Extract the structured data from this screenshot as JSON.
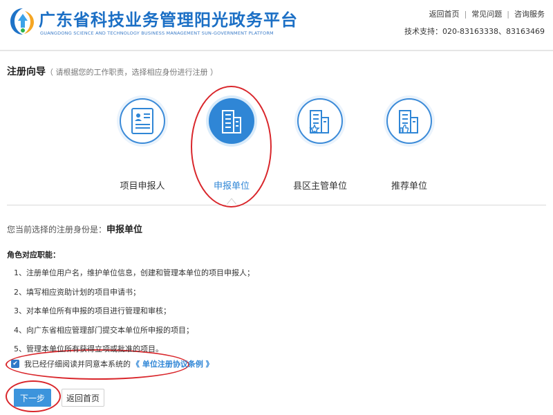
{
  "header": {
    "title": "广东省科技业务管理阳光政务平台",
    "subtitle": "GUANGDONG SCIENCE AND TECHNOLOGY BUSINESS MANAGEMENT SUN-GOVERNMENT PLATFORM",
    "links": [
      "返回首页",
      "常见问题",
      "咨询服务"
    ],
    "support": "技术支持：020-83163338、83163469",
    "brand_color": "#1b6fc5"
  },
  "guide": {
    "title": "注册向导",
    "hint": "（ 请根据您的工作职责，选择相应身份进行注册 ）"
  },
  "roles": [
    {
      "label": "项目申报人",
      "icon": "id-card-icon",
      "active": false
    },
    {
      "label": "申报单位",
      "icon": "building-icon",
      "active": true
    },
    {
      "label": "县区主管单位",
      "icon": "building-star-icon",
      "active": false
    },
    {
      "label": "推荐单位",
      "icon": "building-thumbsup-icon",
      "active": false
    }
  ],
  "current": {
    "prefix": "您当前选择的注册身份是：",
    "value": "申报单位"
  },
  "duties": {
    "title": "角色对应职能：",
    "items": [
      "1、注册单位用户名，维护单位信息，创建和管理本单位的项目申报人；",
      "2、填写相应资助计划的项目申请书；",
      "3、对本单位所有申报的项目进行管理和审核；",
      "4、向广东省相应管理部门提交本单位所申报的项目；",
      "5、管理本单位所有获得立项或批准的项目。"
    ]
  },
  "agreement": {
    "checked": true,
    "text": "我已经仔细阅读并同意本系统的",
    "link": "《 单位注册协议条例 》"
  },
  "buttons": {
    "next": "下一步",
    "home": "返回首页"
  },
  "colors": {
    "accent": "#2f86d6",
    "annotation": "#d9262b"
  }
}
